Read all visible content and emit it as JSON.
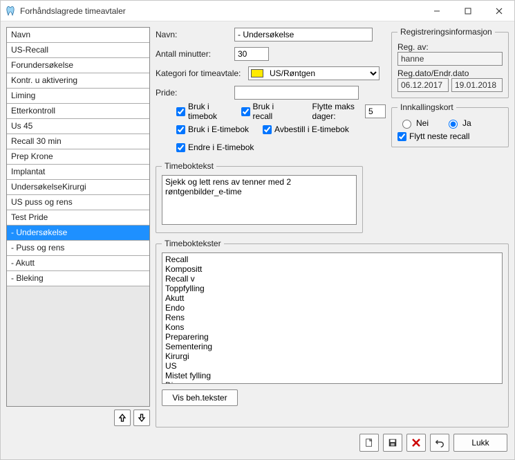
{
  "window": {
    "title": "Forhåndslagrede timeavtaler"
  },
  "list": {
    "items": [
      "Navn",
      "US-Recall",
      "Forundersøkelse",
      "Kontr. u aktivering",
      "Liming",
      "Etterkontroll",
      "Us 45",
      "Recall 30 min",
      "Prep Krone",
      "Implantat",
      "UndersøkelseKirurgi",
      "US puss og rens",
      "Test Pride",
      "- Undersøkelse",
      "- Puss og rens",
      "- Akutt",
      "- Bleking"
    ],
    "selected_index": 13
  },
  "form": {
    "navn_label": "Navn:",
    "navn_value": "- Undersøkelse",
    "minutter_label": "Antall minutter:",
    "minutter_value": "30",
    "kategori_label": "Kategori for timeavtale:",
    "kategori_value": "US/Røntgen",
    "pride_label": "Pride:",
    "pride_value": "",
    "chk_timebok": "Bruk i timebok",
    "chk_recall": "Bruk i recall",
    "chk_etimebok": "Bruk i E-timebok",
    "chk_avbestill": "Avbestill i E-timebok",
    "chk_endre": "Endre i E-timebok",
    "flytte_label": "Flytte maks dager:",
    "flytte_value": "5"
  },
  "reg": {
    "legend": "Registreringsinformasjon",
    "av_label": "Reg. av:",
    "av_value": "hanne",
    "dato_label": "Reg.dato/Endr.dato",
    "dato_reg": "06.12.2017",
    "dato_endr": "19.01.2018"
  },
  "innk": {
    "legend": "Innkallingskort",
    "nei": "Nei",
    "ja": "Ja",
    "flytt": "Flytt neste recall"
  },
  "timebok": {
    "legend": "Timeboktekst",
    "value": "Sjekk og lett rens av tenner med 2 røntgenbilder_e-time"
  },
  "tekster": {
    "legend": "Timeboktekster",
    "items": [
      "Recall",
      "Kompositt",
      "Recall v",
      "Toppfylling",
      "Akutt",
      "Endo",
      "Rens",
      "Kons",
      "Preparering",
      "Sementering",
      "Kirurgi",
      "US",
      "Mistet fylling",
      "Diverse"
    ],
    "button": "Vis beh.tekster"
  },
  "bottom": {
    "lukk": "Lukk"
  }
}
